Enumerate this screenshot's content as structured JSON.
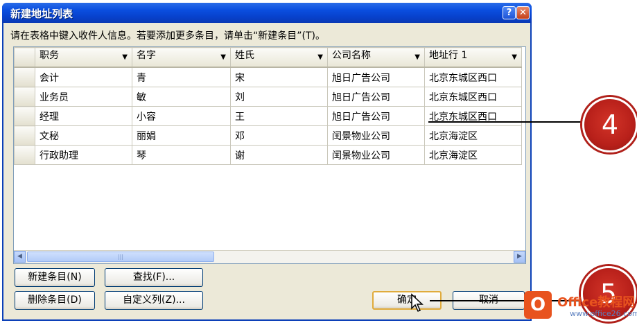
{
  "window": {
    "title": "新建地址列表",
    "help_label": "?",
    "close_label": "✕"
  },
  "instruction": "请在表格中键入收件人信息。若要添加更多条目，请单击“新建条目”(T)。",
  "table": {
    "columns": [
      "职务",
      "名字",
      "姓氏",
      "公司名称",
      "地址行 1"
    ],
    "rows": [
      [
        "会计",
        "青",
        "宋",
        "旭日广告公司",
        "北京东城区西口"
      ],
      [
        "业务员",
        "敏",
        "刘",
        "旭日广告公司",
        "北京东城区西口"
      ],
      [
        "经理",
        "小容",
        "王",
        "旭日广告公司",
        "北京东城区西口"
      ],
      [
        "文秘",
        "丽娟",
        "邓",
        "闰景物业公司",
        "北京海淀区"
      ],
      [
        "行政助理",
        "琴",
        "谢",
        "闰景物业公司",
        "北京海淀区"
      ]
    ]
  },
  "buttons": {
    "new_entry": "新建条目(N)",
    "find": "查找(F)...",
    "delete_entry": "删除条目(D)",
    "customize_columns": "自定义列(Z)...",
    "ok": "确定",
    "cancel": "取消"
  },
  "callouts": {
    "step4": "4",
    "step5": "5"
  },
  "watermark": {
    "mark": "O",
    "name": "Office教程网",
    "url": "www.office26.com"
  }
}
